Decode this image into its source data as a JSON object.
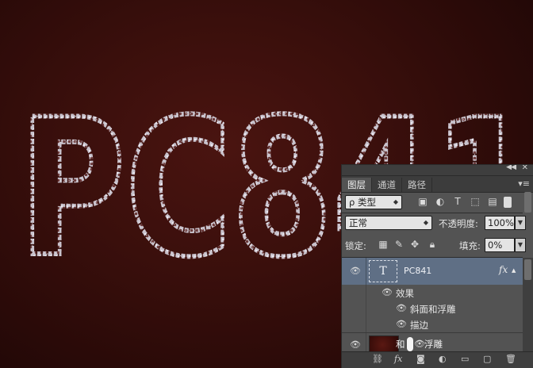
{
  "canvas": {
    "artwork_text": "PC841",
    "background_color": "#3a0f0c",
    "stroke_color": "#c9c3cc"
  },
  "panel": {
    "tabs": [
      {
        "label": "图层"
      },
      {
        "label": "通道"
      },
      {
        "label": "路径"
      }
    ],
    "filter": {
      "label": "ρ 类型"
    },
    "blend_mode": "正常",
    "opacity": {
      "label": "不透明度:",
      "value": "100%"
    },
    "lock": {
      "label": "锁定:"
    },
    "fill": {
      "label": "填充:",
      "value": "0%"
    },
    "layers": [
      {
        "name": "PC841",
        "fx": "fx",
        "thumb": "T"
      }
    ],
    "effects": {
      "header": "效果",
      "items": [
        "斜面和浮雕",
        "描边"
      ]
    },
    "overlap_text": {
      "left": "和",
      "right": "浮雕"
    }
  }
}
